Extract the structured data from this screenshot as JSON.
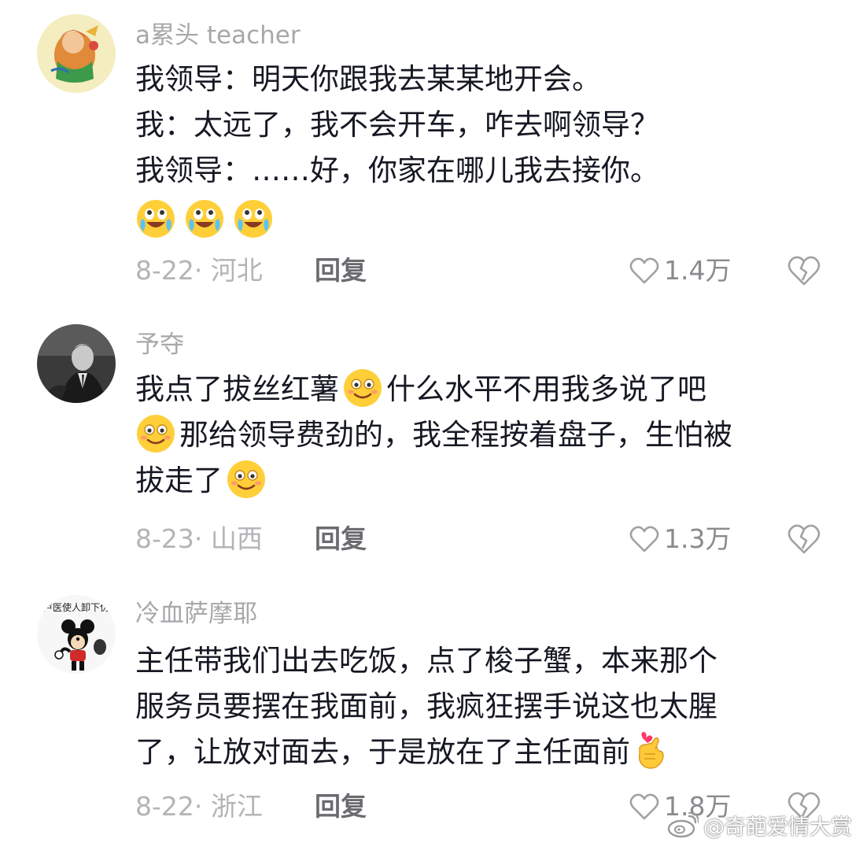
{
  "comments": [
    {
      "username": "a累头 teacher",
      "lines": [
        "我领导：明天你跟我去某某地开会。",
        "我：太远了，我不会开车，咋去啊领导？",
        "我领导：……好，你家在哪儿我去接你。"
      ],
      "emojis": [
        "crying-laughing-emoji",
        "crying-laughing-emoji",
        "crying-laughing-emoji"
      ],
      "date_location": "8-22· 河北",
      "reply_label": "回复",
      "likes": "1.4万"
    },
    {
      "username": "予夺",
      "lines": [
        [
          "我点了拔丝红薯",
          "什么水平不用我多说了吧"
        ],
        [
          "那给领导费劲的，我全程按着盘子，生怕被"
        ],
        [
          "拔走了"
        ]
      ],
      "emojis": [
        "smile-emoji",
        "smile-emoji",
        "smile-emoji"
      ],
      "date_location": "8-23· 山西",
      "reply_label": "回复",
      "likes": "1.3万"
    },
    {
      "username": "冷血萨摩耶",
      "avatar_text": "卢医使人卸下伪",
      "lines": [
        "主任带我们出去吃饭，点了梭子蟹，本来那个",
        "服务员要摆在我面前，我疯狂摆手说这也太腥",
        "了，让放对面去，于是放在了主任面前"
      ],
      "emojis": [
        "finger-heart-emoji"
      ],
      "date_location": "8-22· 浙江",
      "reply_label": "回复",
      "likes": "1.8万"
    }
  ],
  "watermark": "@奇葩爱情大赏",
  "colors": {
    "text": "#161823",
    "username": "#a8a8ac",
    "meta": "#b4b4b8",
    "icon": "#a0a0a5",
    "emoji_face": "#ffcf3a"
  }
}
